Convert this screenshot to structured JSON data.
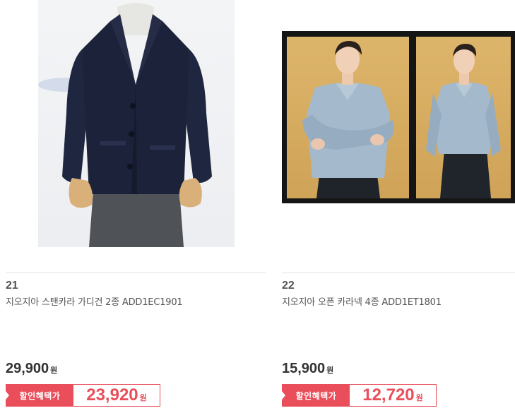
{
  "products": [
    {
      "number": "21",
      "name": "지오지아 스탠카라 가디건 2종 ADD1EC1901",
      "price": "29,900",
      "price_unit": "원",
      "discount_label": "할인혜택가",
      "discount_price": "23,920",
      "discount_unit": "원",
      "image_icon": "cardigan-mannequin-image"
    },
    {
      "number": "22",
      "name": "지오지아 오픈 카라넥 4종 ADD1ET1801",
      "price": "15,900",
      "price_unit": "원",
      "discount_label": "할인혜택가",
      "discount_price": "12,720",
      "discount_unit": "원",
      "image_icon": "model-knit-photo-image"
    }
  ],
  "colors": {
    "accent": "#e94e5a",
    "text": "#555555",
    "price": "#333333"
  }
}
